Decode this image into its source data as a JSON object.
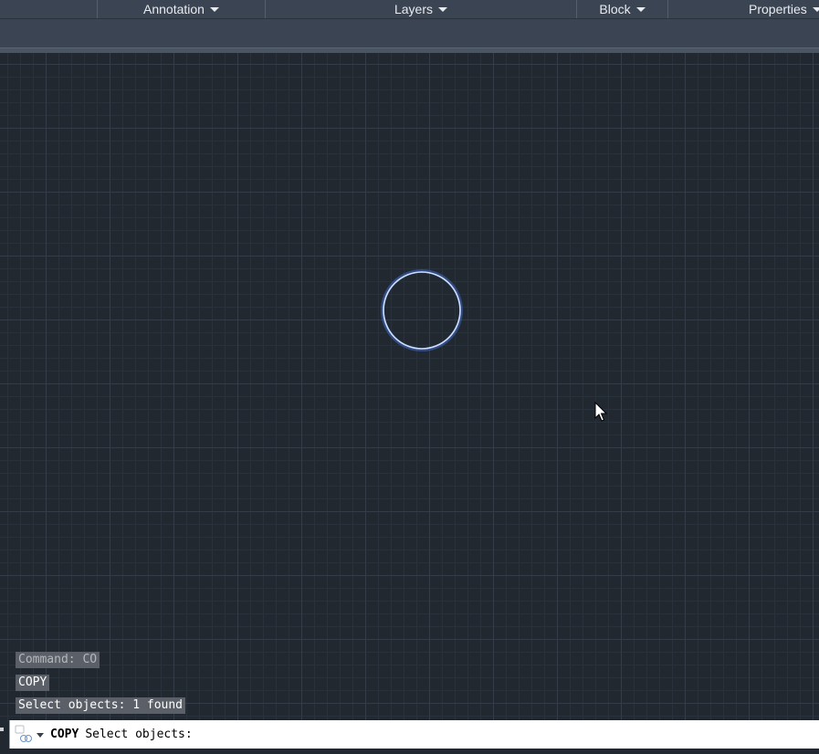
{
  "ribbon": {
    "panels": [
      {
        "label": "Annotation",
        "icon": "chevron-down-icon"
      },
      {
        "label": "Layers",
        "icon": "chevron-down-icon"
      },
      {
        "label": "Block",
        "icon": "chevron-down-icon"
      },
      {
        "label": "Properties",
        "icon": "chevron-down-icon"
      }
    ]
  },
  "canvas": {
    "objects": [
      {
        "type": "circle",
        "state": "selected",
        "color": "#8fb4ff"
      }
    ],
    "cursor_icon": "arrow-cursor-icon"
  },
  "command_history": [
    {
      "text": "Command: CO"
    },
    {
      "text": "COPY"
    },
    {
      "text": "Select objects: 1 found"
    }
  ],
  "command_line": {
    "icon": "command-history-icon",
    "command": "COPY",
    "prompt": "Select objects:",
    "input_value": ""
  },
  "colors": {
    "canvas_background": "#212830",
    "ribbon_background": "#3b4453",
    "grid_major": "#343c48",
    "selection_highlight": "#8fb4ff"
  }
}
